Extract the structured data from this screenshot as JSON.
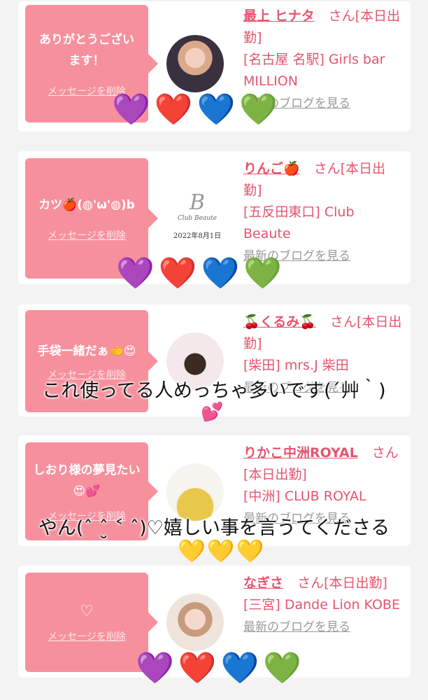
{
  "cards": [
    {
      "message": "ありがとうございます！",
      "delete_label": "メッセージを削除",
      "name": "最上 ヒナタ",
      "san": "さん",
      "status": "[本日出勤]",
      "shop": "[名古屋 名駅] Girls bar MILLION",
      "blog_link": "最新のブログを見る"
    },
    {
      "message": "カツ🍎(◍'ω'◍)b",
      "delete_label": "メッセージを削除",
      "name": "りんご🍎",
      "san": "さん",
      "status": "[本日出勤]",
      "shop": "[五反田東口] Club Beaute",
      "blog_link": "最新のブログを見る",
      "avatar_logo_text": "Club Beaute",
      "avatar_logo_date": "2022年8月1日"
    },
    {
      "message": "手袋一緒だぁ🫲😍",
      "delete_label": "メッセージを削除",
      "name": "🍒くるみ🍒",
      "san": "さん",
      "status": "[本日出勤]",
      "shop": "[柴田] mrs.J 柴田",
      "blog_link": "最新のブログを見る"
    },
    {
      "message": "しおり様の夢見たい😍💕",
      "delete_label": "メッセージを削除",
      "name": "りかこ中洲ROYAL",
      "san": "さん",
      "status": "[本日出勤]",
      "shop": "[中洲] CLUB ROYAL",
      "blog_link": "最新のブログを見る"
    },
    {
      "message": "♡",
      "delete_label": "メッセージを削除",
      "name": "なぎさ",
      "san": "さん",
      "status": "[本日出勤]",
      "shop": "[三宮] Dande Lion KOBE",
      "blog_link": "最新のブログを見る"
    }
  ],
  "overlay": {
    "caption1": "これ使ってる人めっちゃ多いです(´艸｀)",
    "caption1_emoji": "💕",
    "caption2": "やん(ˆ ˆ̮ ˂ ˆ)♡嬉しい事を言うてくださる",
    "hearts_colored": [
      "💜",
      "❤️",
      "💙",
      "💚"
    ],
    "hearts_yellow": [
      "💛",
      "💛",
      "💛"
    ]
  },
  "colors": {
    "bubble": "#f7909d",
    "name_pink": "#e5546e",
    "background": "#f3f3f3"
  }
}
